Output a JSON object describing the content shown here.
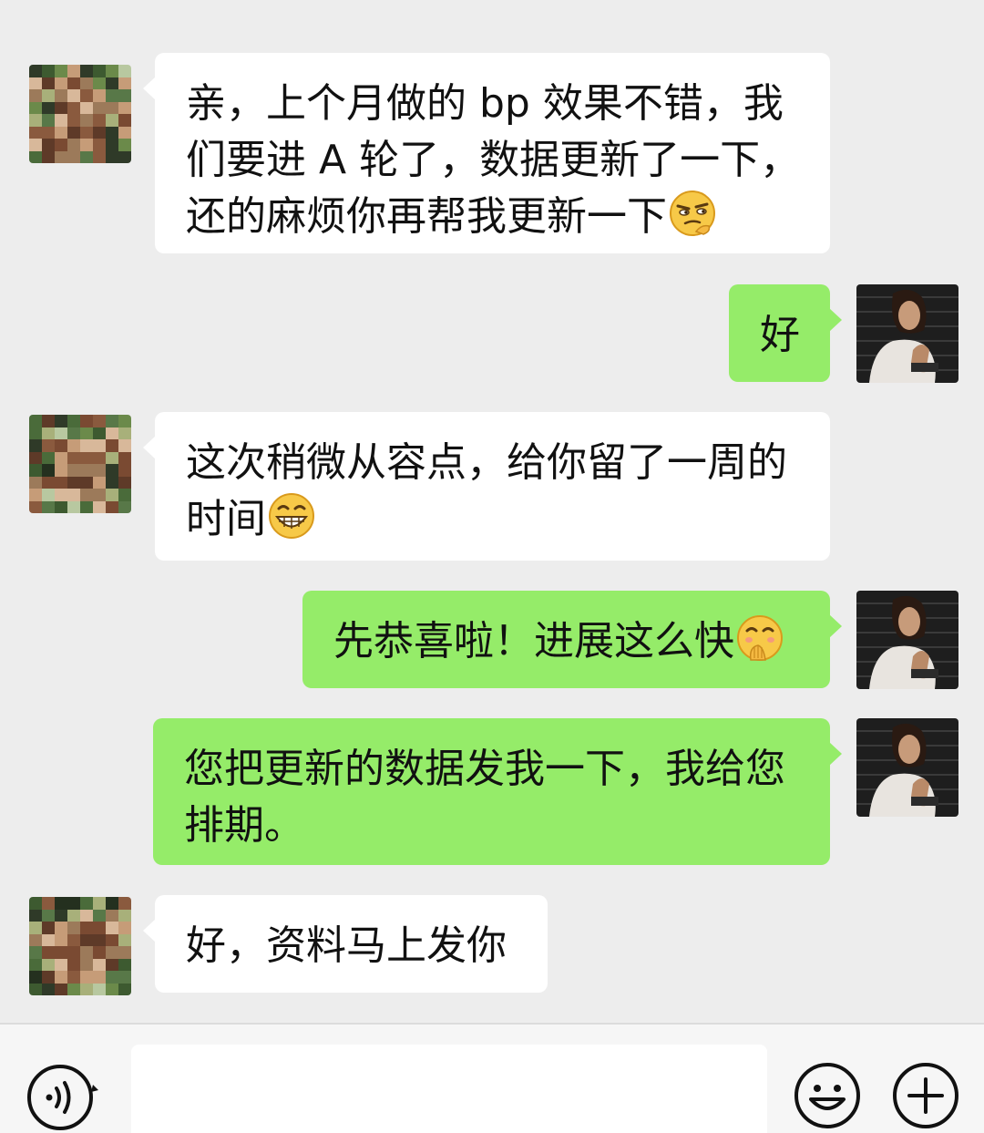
{
  "messages": [
    {
      "side": "left",
      "lines": [
        "亲，上个月做的 bp 效果不错，我",
        "们要进 A 轮了，数据更新了一下，",
        "还的麻烦你再帮我更新一下"
      ],
      "emoji": "skeptical-emoji"
    },
    {
      "side": "right",
      "lines": [
        "好"
      ]
    },
    {
      "side": "left",
      "lines": [
        "这次稍微从容点，给你留了一周的",
        "时间"
      ],
      "emoji": "grin-emoji"
    },
    {
      "side": "right",
      "lines": [
        "先恭喜啦！进展这么快"
      ],
      "emoji": "facepalm-smile-emoji"
    },
    {
      "side": "right",
      "lines": [
        "您把更新的数据发我一下，我给您",
        "排期。"
      ]
    },
    {
      "side": "left",
      "lines": [
        "好，资料马上发你"
      ]
    }
  ],
  "input_bar": {
    "placeholder": "",
    "icons": [
      "voice-icon",
      "emoji-icon",
      "plus-icon"
    ]
  },
  "colors": {
    "background": "#ededed",
    "bubble_self": "#95ec69",
    "bubble_other": "#ffffff"
  }
}
